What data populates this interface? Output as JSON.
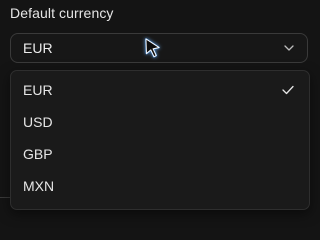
{
  "field": {
    "label": "Default currency",
    "selected_value": "EUR"
  },
  "menu": {
    "items": [
      {
        "label": "EUR",
        "selected": true
      },
      {
        "label": "USD",
        "selected": false
      },
      {
        "label": "GBP",
        "selected": false
      },
      {
        "label": "MXN",
        "selected": false
      }
    ]
  },
  "icons": {
    "trigger": "chevron-down-icon",
    "selected_item": "checkmark-icon",
    "pointer": "mouse-cursor-icon"
  },
  "colors": {
    "background": "#141414",
    "menu_background": "#1a1a1a",
    "border": "#3a3a3a",
    "text": "#e6e6e6",
    "cursor_glow": "#6fb4ff"
  }
}
